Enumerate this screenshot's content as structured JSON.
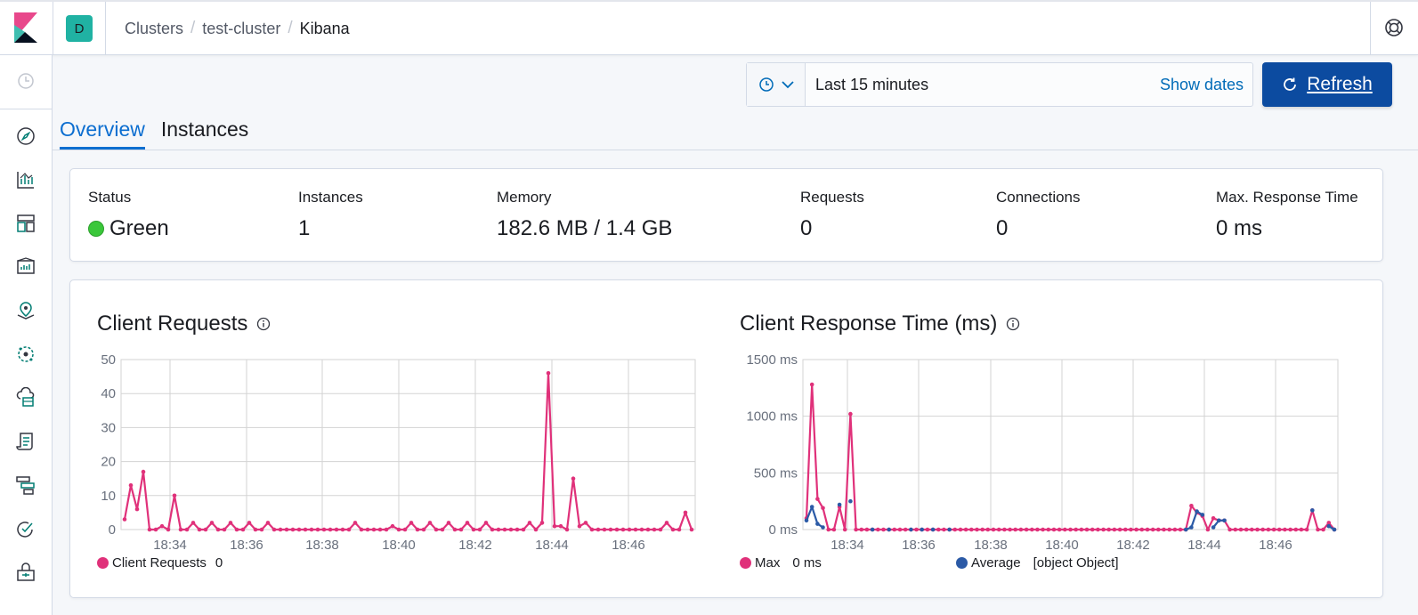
{
  "header": {
    "space_initial": "D",
    "breadcrumbs": [
      "Clusters",
      "test-cluster",
      "Kibana"
    ]
  },
  "sidebar": {
    "items": [
      "clock-icon",
      "discover-icon",
      "visualize-icon",
      "dashboard-icon",
      "canvas-icon",
      "maps-icon",
      "ml-icon",
      "infrastructure-icon",
      "logs-icon",
      "apm-icon",
      "uptime-icon",
      "dev-tools-icon"
    ]
  },
  "toolbar": {
    "time_range": "Last 15 minutes",
    "show_dates": "Show dates",
    "refresh": "Refresh"
  },
  "tabs": [
    "Overview",
    "Instances"
  ],
  "stats": [
    {
      "title": "Status",
      "value": "Green"
    },
    {
      "title": "Instances",
      "value": "1"
    },
    {
      "title": "Memory",
      "value": "182.6 MB / 1.4 GB"
    },
    {
      "title": "Requests",
      "value": "0"
    },
    {
      "title": "Connections",
      "value": "0"
    },
    {
      "title": "Max. Response Time",
      "value": "0 ms"
    }
  ],
  "colors": {
    "pink": "#e0317a",
    "blue": "#2b5aa6",
    "green": "#3ac73a",
    "accent": "#0c4ba0"
  },
  "chart_data": [
    {
      "type": "line",
      "title": "Client Requests",
      "x_ticks": [
        "18:34",
        "18:36",
        "18:38",
        "18:40",
        "18:42",
        "18:44",
        "18:46"
      ],
      "y_ticks": [
        "0",
        "10",
        "20",
        "30",
        "40",
        "50"
      ],
      "ylim": [
        0,
        50
      ],
      "series": [
        {
          "name": "Client Requests",
          "legend_value": "0",
          "color": "#e0317a",
          "values": [
            3,
            13,
            6,
            17,
            0,
            0,
            1,
            0,
            10,
            0,
            0,
            2,
            0,
            0,
            2,
            0,
            0,
            2,
            0,
            0,
            2,
            0,
            0,
            2,
            0,
            0,
            0,
            0,
            0,
            0,
            0,
            0,
            0,
            0,
            0,
            0,
            0,
            2,
            0,
            0,
            0,
            0,
            0,
            1,
            0,
            0,
            2,
            0,
            0,
            2,
            0,
            0,
            2,
            0,
            0,
            2,
            0,
            0,
            2,
            0,
            0,
            0,
            0,
            0,
            0,
            2,
            0,
            2,
            46,
            1,
            1,
            0,
            15,
            1,
            2,
            0,
            0,
            0,
            0,
            0,
            0,
            0,
            0,
            0,
            0,
            0,
            0,
            2,
            0,
            0,
            5,
            0
          ]
        }
      ]
    },
    {
      "type": "line",
      "title": "Client Response Time (ms)",
      "x_ticks": [
        "18:34",
        "18:36",
        "18:38",
        "18:40",
        "18:42",
        "18:44",
        "18:46"
      ],
      "y_ticks": [
        "0 ms",
        "500 ms",
        "1000 ms",
        "1500 ms"
      ],
      "ylim": [
        0,
        1500
      ],
      "series": [
        {
          "name": "Max",
          "legend_value": "0 ms",
          "color": "#e0317a",
          "values": [
            100,
            1280,
            270,
            190,
            0,
            0,
            200,
            0,
            1020,
            0,
            0,
            0,
            0,
            0,
            0,
            0,
            0,
            0,
            0,
            0,
            0,
            0,
            0,
            0,
            0,
            0,
            0,
            0,
            0,
            0,
            0,
            0,
            0,
            0,
            0,
            0,
            0,
            0,
            0,
            0,
            0,
            0,
            0,
            0,
            0,
            0,
            0,
            0,
            0,
            0,
            0,
            0,
            0,
            0,
            0,
            0,
            0,
            0,
            0,
            0,
            0,
            0,
            0,
            0,
            0,
            0,
            0,
            0,
            0,
            0,
            210,
            150,
            120,
            0,
            100,
            80,
            80,
            0,
            0,
            0,
            0,
            0,
            0,
            0,
            0,
            0,
            0,
            0,
            0,
            0,
            0,
            0,
            170,
            0,
            0,
            60,
            0
          ]
        },
        {
          "name": "Average",
          "legend_value": "[object Object]",
          "color": "#2b5aa6",
          "values": [
            80,
            200,
            50,
            20,
            null,
            null,
            220,
            null,
            250,
            null,
            null,
            null,
            0,
            null,
            null,
            0,
            null,
            null,
            null,
            0,
            null,
            0,
            null,
            0,
            null,
            null,
            0,
            null,
            null,
            null,
            null,
            null,
            null,
            null,
            null,
            null,
            null,
            null,
            null,
            null,
            null,
            null,
            null,
            null,
            null,
            null,
            null,
            null,
            null,
            null,
            null,
            null,
            null,
            null,
            null,
            null,
            null,
            null,
            null,
            null,
            null,
            null,
            null,
            null,
            null,
            null,
            null,
            null,
            null,
            0,
            20,
            160,
            130,
            null,
            20,
            80,
            80,
            null,
            null,
            null,
            null,
            null,
            null,
            null,
            null,
            null,
            null,
            null,
            null,
            null,
            null,
            null,
            170,
            null,
            null,
            30,
            0
          ]
        }
      ]
    }
  ]
}
